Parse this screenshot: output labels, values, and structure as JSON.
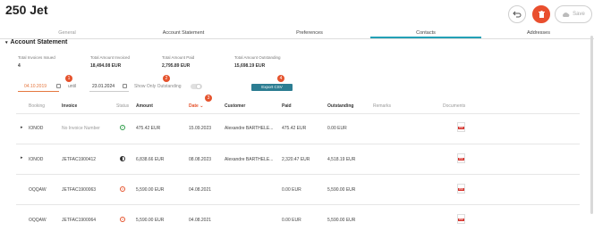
{
  "header": {
    "title": "250 Jet",
    "save_label": "Save"
  },
  "tabs": [
    {
      "label": "General",
      "state": "dim"
    },
    {
      "label": "Account Statement",
      "state": "normal"
    },
    {
      "label": "Preferences",
      "state": "normal"
    },
    {
      "label": "Contacts",
      "state": "active"
    },
    {
      "label": "Addresses",
      "state": "normal"
    }
  ],
  "section_title": "Account Statement",
  "summary": [
    {
      "label": "Total Invoices Issued",
      "value": "4"
    },
    {
      "label": "Total Amount Invoiced",
      "value": "18,494.08 EUR"
    },
    {
      "label": "Total Amount Paid",
      "value": "2,795.89 EUR"
    },
    {
      "label": "Total Amount Outstanding",
      "value": "15,698.19 EUR"
    }
  ],
  "filters": {
    "from_date": "04.10.2019",
    "until_label": "until",
    "to_date": "23.01.2024",
    "outstanding_label": "Show Only Outstanding",
    "export_label": "Export CSV",
    "badges": [
      "1",
      "2",
      "3",
      "4"
    ]
  },
  "table": {
    "headers": [
      "Booking",
      "Invoice",
      "Status",
      "Amount",
      "Date",
      "Customer",
      "Paid",
      "Outstanding",
      "Remarks",
      "Documents"
    ],
    "rows": [
      {
        "expand": "▸",
        "booking": "IONOD",
        "invoice": "No Invoice Number",
        "status": "paid",
        "amount": "475.42 EUR",
        "date": "15.09.2023",
        "customer": "Alexandre BARTHELE...",
        "paid": "475.42 EUR",
        "outstanding": "0.00 EUR"
      },
      {
        "expand": "▸",
        "booking": "IONOD",
        "invoice": "JETFAC1900412",
        "status": "partial",
        "amount": "6,838.66 EUR",
        "date": "08.08.2023",
        "customer": "Alexandre BARTHELE...",
        "paid": "2,320.47 EUR",
        "outstanding": "4,518.19 EUR"
      },
      {
        "expand": "",
        "booking": "OQQAW",
        "invoice": "JETFAC1900063",
        "status": "unpaid",
        "amount": "5,590.00 EUR",
        "date": "04.08.2021",
        "customer": "",
        "paid": "0.00 EUR",
        "outstanding": "5,590.00 EUR"
      },
      {
        "expand": "",
        "booking": "OQQAW",
        "invoice": "JETFAC1900064",
        "status": "unpaid",
        "amount": "5,590.00 EUR",
        "date": "04.08.2021",
        "customer": "",
        "paid": "0.00 EUR",
        "outstanding": "5,590.00 EUR"
      }
    ]
  },
  "colors": {
    "accent": "#23a0b5",
    "danger": "#e94f2e",
    "badge": "#e5532d",
    "export": "#2c7d92"
  }
}
